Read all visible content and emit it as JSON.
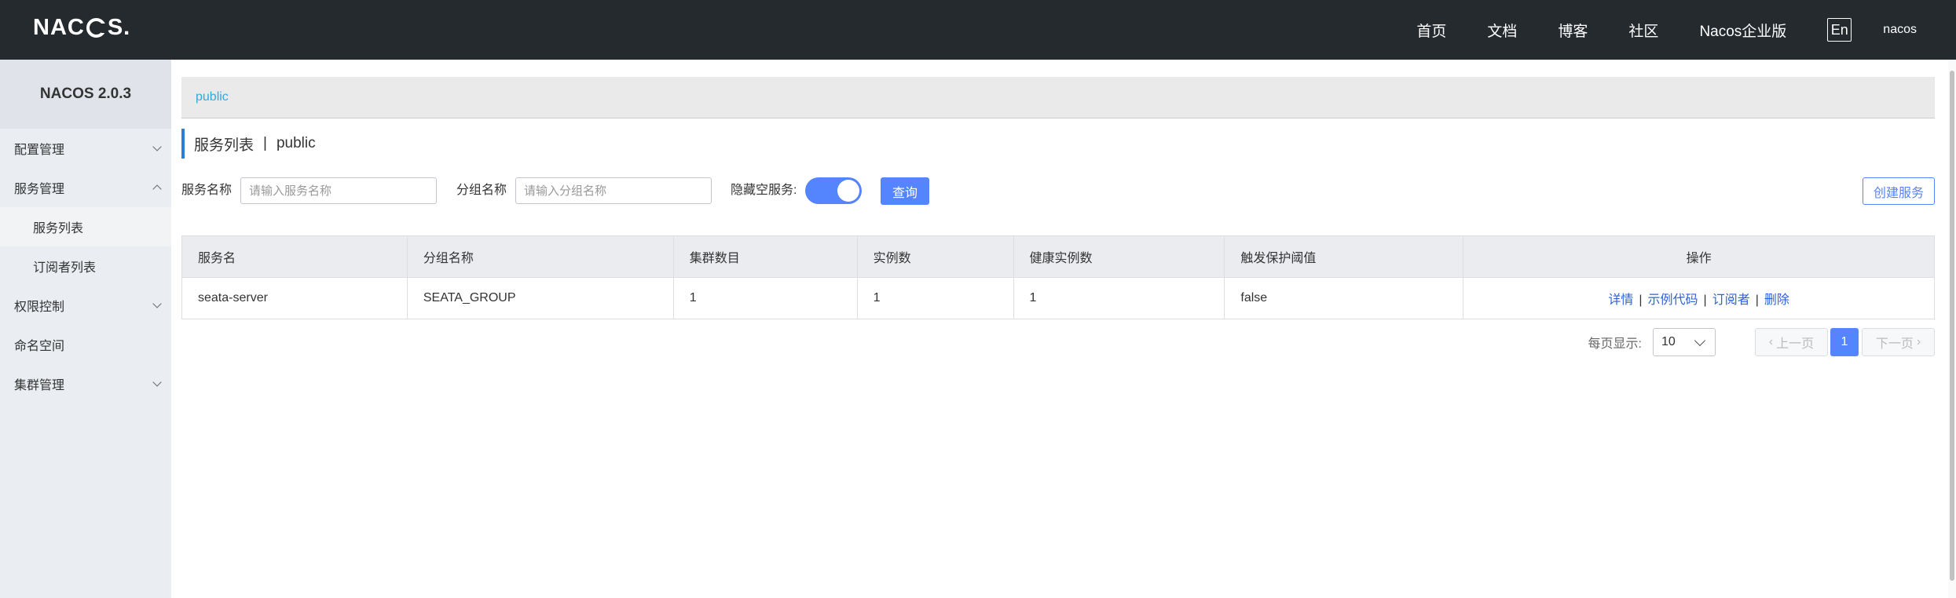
{
  "header": {
    "logo_text_left": "NAC",
    "logo_text_right": "S.",
    "nav": [
      "首页",
      "文档",
      "博客",
      "社区",
      "Nacos企业版"
    ],
    "lang_toggle": "En",
    "username": "nacos"
  },
  "sidebar": {
    "title": "NACOS 2.0.3",
    "items": [
      {
        "label": "配置管理"
      },
      {
        "label": "服务管理"
      },
      {
        "label": "服务列表"
      },
      {
        "label": "订阅者列表"
      },
      {
        "label": "权限控制"
      },
      {
        "label": "命名空间"
      },
      {
        "label": "集群管理"
      }
    ]
  },
  "namespace_bar": {
    "active": "public"
  },
  "page": {
    "title": "服务列表",
    "separator": "|",
    "namespace": "public"
  },
  "filter": {
    "service_name_label": "服务名称",
    "service_name_placeholder": "请输入服务名称",
    "group_name_label": "分组名称",
    "group_name_placeholder": "请输入分组名称",
    "hide_empty_label": "隐藏空服务:",
    "hide_empty_on": true,
    "query_button": "查询",
    "create_button": "创建服务"
  },
  "table": {
    "columns": [
      "服务名",
      "分组名称",
      "集群数目",
      "实例数",
      "健康实例数",
      "触发保护阈值",
      "操作"
    ],
    "rows": [
      {
        "service": "seata-server",
        "group": "SEATA_GROUP",
        "clusters": "1",
        "instances": "1",
        "healthy": "1",
        "threshold": "false",
        "ops": [
          "详情",
          "示例代码",
          "订阅者",
          "删除"
        ],
        "op_sep": "|"
      }
    ]
  },
  "pagination": {
    "page_size_label": "每页显示:",
    "page_size": "10",
    "prev": "上一页",
    "current_page": "1",
    "next": "下一页"
  },
  "colors": {
    "topbar": "#252a2f",
    "primary": "#5584ff",
    "link": "#2f62d6",
    "ns_link": "#33a7e0"
  }
}
